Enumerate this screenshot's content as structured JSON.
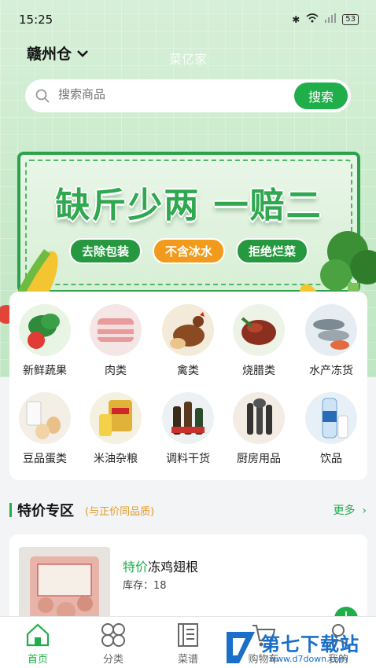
{
  "status": {
    "time": "15:25",
    "battery": "53"
  },
  "header": {
    "location": "赣州仓",
    "app_title": "菜亿家"
  },
  "search": {
    "placeholder": "搜索商品",
    "button": "搜索"
  },
  "banner": {
    "headline": "缺斤少两 一赔二",
    "tags": [
      "去除包装",
      "不含冰水",
      "拒绝烂菜"
    ]
  },
  "categories": [
    {
      "label": "新鲜蔬果",
      "icon": "vegetables-icon"
    },
    {
      "label": "肉类",
      "icon": "meat-icon"
    },
    {
      "label": "禽类",
      "icon": "poultry-icon"
    },
    {
      "label": "烧腊类",
      "icon": "roast-meat-icon"
    },
    {
      "label": "水产冻货",
      "icon": "seafood-icon"
    },
    {
      "label": "豆品蛋类",
      "icon": "eggs-icon"
    },
    {
      "label": "米油杂粮",
      "icon": "rice-oil-icon"
    },
    {
      "label": "调料干货",
      "icon": "seasoning-icon"
    },
    {
      "label": "厨房用品",
      "icon": "kitchenware-icon"
    },
    {
      "label": "饮品",
      "icon": "drinks-icon"
    }
  ],
  "special": {
    "title": "特价专区",
    "subtitle": "(与正价同品质)",
    "more": "更多"
  },
  "product": {
    "tag": "特价",
    "name": "冻鸡翅根",
    "stock": "库存：18"
  },
  "tabs": [
    {
      "label": "首页",
      "icon": "home-icon",
      "active": true
    },
    {
      "label": "分类",
      "icon": "category-icon",
      "active": false
    },
    {
      "label": "菜谱",
      "icon": "recipe-icon",
      "active": false
    },
    {
      "label": "购物车",
      "icon": "cart-icon",
      "active": false
    },
    {
      "label": "我的",
      "icon": "profile-icon",
      "active": false
    }
  ],
  "watermark": {
    "text": "第七下载站",
    "url": "www.d7down.com"
  },
  "colors": {
    "accent": "#1fae4a",
    "orange": "#f29a1c",
    "brand_blue": "#1a6fc9"
  }
}
